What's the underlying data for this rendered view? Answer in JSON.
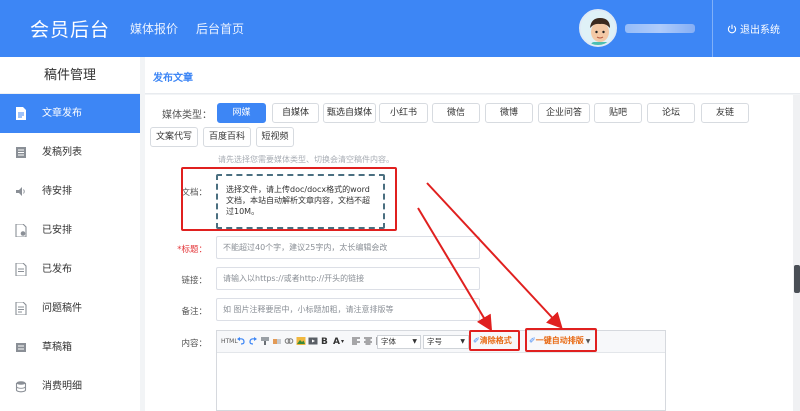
{
  "app": {
    "brand": "会员后台",
    "nav": [
      "媒体报价",
      "后台首页"
    ],
    "logout": "退出系统"
  },
  "sidebar": {
    "title": "稿件管理",
    "items": [
      {
        "label": "文章发布",
        "icon": "document-icon",
        "active": true
      },
      {
        "label": "发稿列表",
        "icon": "list-icon",
        "active": false
      },
      {
        "label": "待安排",
        "icon": "speaker-icon",
        "active": false
      },
      {
        "label": "已安排",
        "icon": "check-doc-icon",
        "active": false
      },
      {
        "label": "已发布",
        "icon": "doc-published-icon",
        "active": false
      },
      {
        "label": "问题稿件",
        "icon": "doc-problem-icon",
        "active": false
      },
      {
        "label": "草稿箱",
        "icon": "draft-icon",
        "active": false
      },
      {
        "label": "消费明细",
        "icon": "coins-icon",
        "active": false
      }
    ]
  },
  "page": {
    "heading": "发布文章",
    "media_label": "媒体类型：",
    "media_types": [
      "网媒",
      "自媒体",
      "甄选自媒体",
      "小红书",
      "微信",
      "微博",
      "企业问答",
      "贴吧",
      "论坛",
      "友链",
      "文案代写",
      "百度百科",
      "短视频"
    ],
    "selected_media": "网媒",
    "hint": "请先选择您需要媒体类型、切换会清空稿件内容。"
  },
  "form": {
    "doc_label": "文档：",
    "upload_text": "选择文件，请上传doc/docx格式的word文档，本站自动解析文章内容，文档不超过10M。",
    "title_label": "标题：",
    "title_required": "*",
    "title_placeholder": "不能超过40个字，建议25字内，太长编辑会改",
    "link_label": "链接：",
    "link_placeholder": "请输入以https://或者http://开头的链接",
    "remark_label": "备注：",
    "remark_placeholder": "如 图片注释要居中，小标题加粗，请注意排版等",
    "content_label": "内容："
  },
  "editor": {
    "html_label": "HTML",
    "font_select": "字体",
    "size_select": "字号",
    "clear_format": "清除格式",
    "auto_format": "一键自动排版",
    "bold": "B",
    "font_color": "A"
  },
  "colors": {
    "primary": "#3d86f5",
    "annotation_red": "#e0201f"
  }
}
